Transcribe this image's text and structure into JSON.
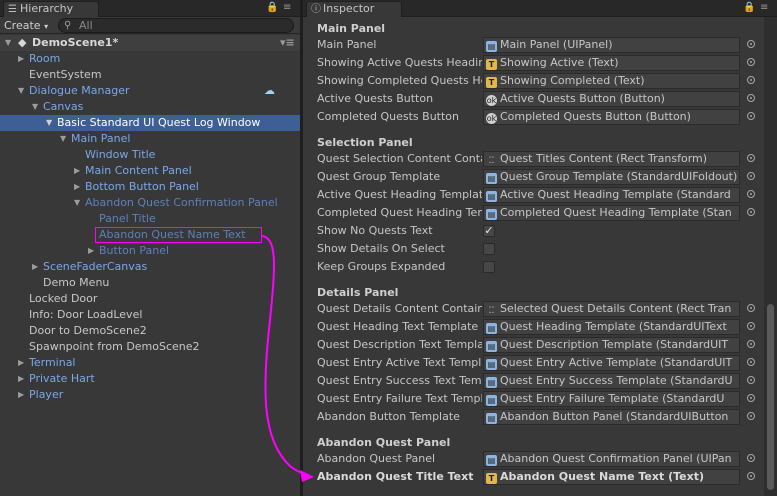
{
  "hierarchy": {
    "tab_label": "Hierarchy",
    "create_label": "Create",
    "search_placeholder": "All",
    "rows": [
      {
        "label": "DemoScene1*",
        "style": "scene"
      },
      {
        "label": "Room",
        "style": "blue"
      },
      {
        "label": "EventSystem",
        "style": "white"
      },
      {
        "label": "Dialogue Manager",
        "style": "blue"
      },
      {
        "label": "Canvas",
        "style": "blue"
      },
      {
        "label": "Basic Standard UI Quest Log Window",
        "style": "selected"
      },
      {
        "label": "Main Panel",
        "style": "blue"
      },
      {
        "label": "Window Title",
        "style": "blue"
      },
      {
        "label": "Main Content Panel",
        "style": "blue"
      },
      {
        "label": "Bottom Button Panel",
        "style": "blue"
      },
      {
        "label": "Abandon Quest Confirmation Panel",
        "style": "dim"
      },
      {
        "label": "Panel Title",
        "style": "dim"
      },
      {
        "label": "Abandon Quest Name Text",
        "style": "dim"
      },
      {
        "label": "Button Panel",
        "style": "dim"
      },
      {
        "label": "SceneFaderCanvas",
        "style": "blue"
      },
      {
        "label": "Demo Menu",
        "style": "white"
      },
      {
        "label": "Locked Door",
        "style": "white"
      },
      {
        "label": "Info: Door LoadLevel",
        "style": "white"
      },
      {
        "label": "Door to DemoScene2",
        "style": "white"
      },
      {
        "label": "Spawnpoint from DemoScene2",
        "style": "white"
      },
      {
        "label": "Terminal",
        "style": "blue"
      },
      {
        "label": "Private Hart",
        "style": "blue"
      },
      {
        "label": "Player",
        "style": "blue"
      }
    ]
  },
  "inspector": {
    "tab_label": "Inspector",
    "sections": {
      "main": "Main Panel",
      "selection": "Selection Panel",
      "details": "Details Panel",
      "abandon": "Abandon Quest Panel"
    },
    "props": [
      {
        "label": "Main Panel",
        "value": "Main Panel (UIPanel)",
        "icon": "panel-icon"
      },
      {
        "label": "Showing Active Quests Heading",
        "value": "Showing Active (Text)",
        "icon": "text-icon"
      },
      {
        "label": "Showing Completed Quests Heading",
        "value": "Showing Completed (Text)",
        "icon": "text-icon"
      },
      {
        "label": "Active Quests Button",
        "value": "Active Quests Button (Button)",
        "icon": "button-icon"
      },
      {
        "label": "Completed Quests Button",
        "value": "Completed Quests Button (Button)",
        "icon": "button-icon"
      },
      {
        "label": "Quest Selection Content Container",
        "value": "Quest Titles Content (Rect Transform)",
        "icon": "rect-transform-icon"
      },
      {
        "label": "Quest Group Template",
        "value": "Quest Group Template (StandardUIFoldout)",
        "icon": "panel-icon"
      },
      {
        "label": "Active Quest Heading Template",
        "value": "Active Quest Heading Template (Standard",
        "icon": "panel-icon"
      },
      {
        "label": "Completed Quest Heading Template",
        "value": "Completed Quest Heading Template (Stan",
        "icon": "panel-icon"
      },
      {
        "label": "Show No Quests Text",
        "value": "",
        "checkbox": true
      },
      {
        "label": "Show Details On Select",
        "value": "",
        "checkbox": false
      },
      {
        "label": "Keep Groups Expanded",
        "value": "",
        "checkbox": false
      },
      {
        "label": "Quest Details Content Container",
        "value": "Selected Quest Details Content (Rect Tran",
        "icon": "rect-transform-icon"
      },
      {
        "label": "Quest Heading Text Template",
        "value": "Quest Heading Template (StandardUIText",
        "icon": "panel-icon"
      },
      {
        "label": "Quest Description Text Template",
        "value": "Quest Description Template (StandardUIT",
        "icon": "panel-icon"
      },
      {
        "label": "Quest Entry Active Text Template",
        "value": "Quest Entry Active Template (StandardUIT",
        "icon": "panel-icon"
      },
      {
        "label": "Quest Entry Success Text Template",
        "value": "Quest Entry Success Template (StandardU",
        "icon": "panel-icon"
      },
      {
        "label": "Quest Entry Failure Text Template",
        "value": "Quest Entry Failure Template (StandardU",
        "icon": "panel-icon"
      },
      {
        "label": "Abandon Button Template",
        "value": "Abandon Button Panel (StandardUIButton",
        "icon": "panel-icon"
      },
      {
        "label": "Abandon Quest Panel",
        "value": "Abandon Quest Confirmation Panel (UIPan",
        "icon": "panel-icon"
      },
      {
        "label": "Abandon Quest Title Text",
        "value": "Abandon Quest Name Text (Text)",
        "icon": "text-icon"
      }
    ],
    "checkmark_glyph": "✓",
    "checkbox_states": {
      "show_no_quests_text": true,
      "show_details_on_select": false,
      "keep_groups_expanded": false
    }
  },
  "colors": {
    "selection": "#3e5f96",
    "highlight_box": "#ff00ff",
    "prefab_blue": "#7aa7e6"
  }
}
